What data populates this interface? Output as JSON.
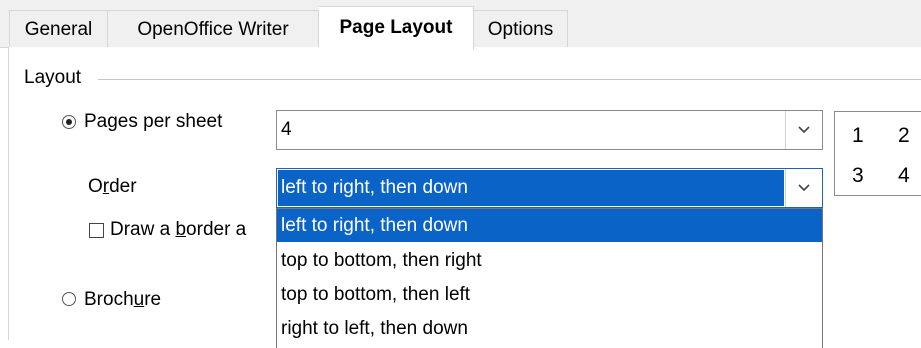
{
  "tabs": [
    {
      "label": "General",
      "active": false
    },
    {
      "label": "OpenOffice Writer",
      "active": false
    },
    {
      "label": "Page Layout",
      "active": true
    },
    {
      "label": "Options",
      "active": false
    }
  ],
  "layout": {
    "frame_title": "Layout",
    "pages_per_sheet": {
      "label": "Pages per sheet",
      "selected": true,
      "value": "4"
    },
    "order": {
      "label_pre": "O",
      "label_accel": "r",
      "label_post": "der",
      "value": "left to right, then down",
      "options": [
        "left to right, then down",
        "top to bottom, then right",
        "top to bottom, then left",
        "right to left, then down"
      ],
      "highlighted_index": 0
    },
    "draw_border": {
      "label_pre": "Draw a ",
      "label_accel": "b",
      "label_post": "order a",
      "checked": false
    },
    "brochure": {
      "label_pre": "Broch",
      "label_accel": "u",
      "label_post": "re",
      "selected": false
    },
    "preview": {
      "cells": [
        "1",
        "2",
        "3",
        "4"
      ]
    }
  },
  "colors": {
    "selection": "#0a64c8",
    "tab_bg": "#f0f0f0"
  }
}
